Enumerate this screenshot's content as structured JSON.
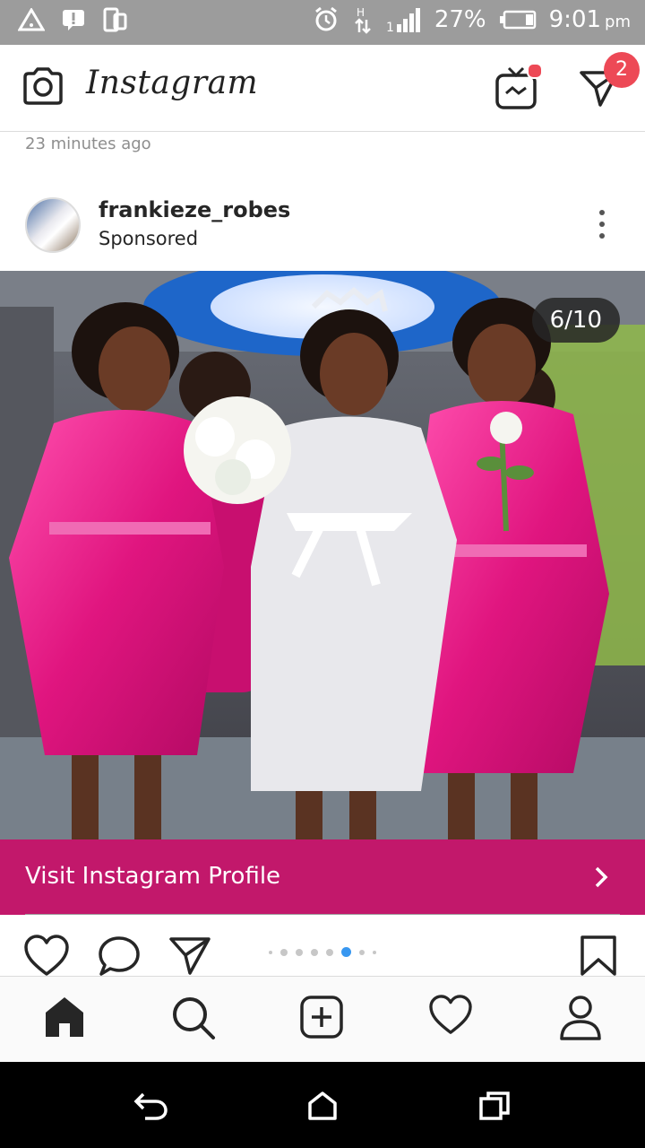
{
  "status_bar": {
    "battery_percent": "27%",
    "time": "9:01",
    "time_suffix": "pm",
    "icons": [
      "warning-icon",
      "alert-icon",
      "screen-icon",
      "alarm-icon",
      "data-icon",
      "signal-icon",
      "battery-icon"
    ]
  },
  "header": {
    "app_name": "Instagram",
    "dm_badge_count": "2",
    "icons": [
      "camera-icon",
      "igtv-icon",
      "direct-message-icon"
    ]
  },
  "feed": {
    "time_ago": "23 minutes ago"
  },
  "post": {
    "username": "frankieze_robes",
    "label": "Sponsored",
    "carousel_counter": "6/10",
    "carousel_index": 6,
    "carousel_total": 10,
    "cta_label": "Visit Instagram Profile",
    "cta_color": "#c2186b"
  },
  "tabs": [
    "home-icon",
    "search-icon",
    "new-post-icon",
    "activity-icon",
    "profile-icon"
  ],
  "colors": {
    "accent_blue": "#3897f0",
    "badge_red": "#ed4956",
    "status_bar": "#9c9c9c"
  }
}
